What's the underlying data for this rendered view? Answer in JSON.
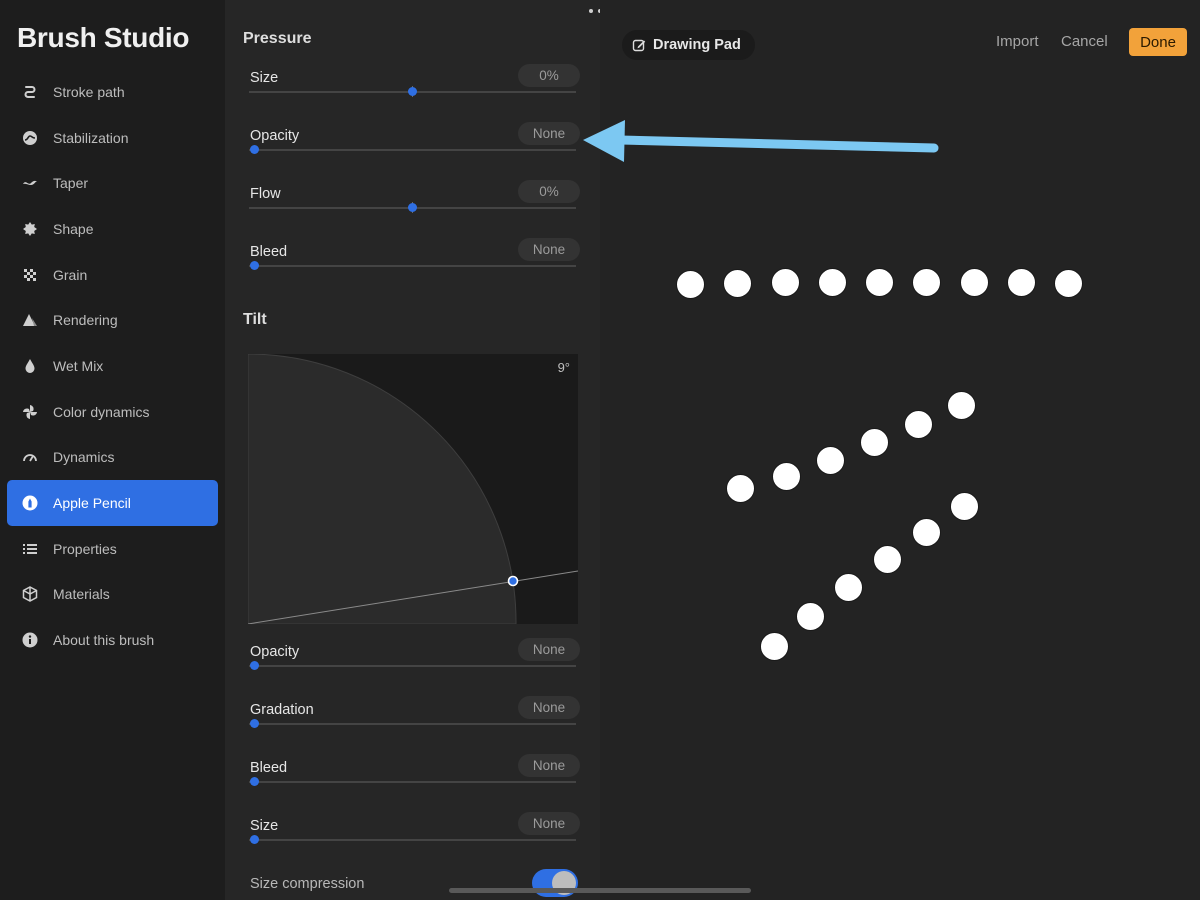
{
  "app_title": "Brush Studio",
  "sidebar": {
    "items": [
      {
        "label": "Stroke path",
        "icon": "stroke-path-icon"
      },
      {
        "label": "Stabilization",
        "icon": "stabilization-icon"
      },
      {
        "label": "Taper",
        "icon": "taper-icon"
      },
      {
        "label": "Shape",
        "icon": "shape-icon"
      },
      {
        "label": "Grain",
        "icon": "grain-icon"
      },
      {
        "label": "Rendering",
        "icon": "rendering-icon"
      },
      {
        "label": "Wet Mix",
        "icon": "wet-mix-icon"
      },
      {
        "label": "Color dynamics",
        "icon": "color-dynamics-icon"
      },
      {
        "label": "Dynamics",
        "icon": "dynamics-icon"
      },
      {
        "label": "Apple Pencil",
        "icon": "apple-pencil-icon",
        "active": true
      },
      {
        "label": "Properties",
        "icon": "properties-icon"
      },
      {
        "label": "Materials",
        "icon": "materials-icon"
      },
      {
        "label": "About this brush",
        "icon": "info-icon"
      }
    ]
  },
  "panel": {
    "pressure": {
      "title": "Pressure",
      "rows": [
        {
          "label": "Size",
          "value": "0%",
          "level": 0.5
        },
        {
          "label": "Opacity",
          "value": "None",
          "level": 0
        },
        {
          "label": "Flow",
          "value": "0%",
          "level": 0.5
        },
        {
          "label": "Bleed",
          "value": "None",
          "level": 0
        }
      ]
    },
    "tilt": {
      "title": "Tilt",
      "angle": "9°",
      "rows": [
        {
          "label": "Opacity",
          "value": "None",
          "level": 0
        },
        {
          "label": "Gradation",
          "value": "None",
          "level": 0
        },
        {
          "label": "Bleed",
          "value": "None",
          "level": 0
        },
        {
          "label": "Size",
          "value": "None",
          "level": 0
        }
      ]
    },
    "size_compression": {
      "label": "Size compression",
      "on": true
    }
  },
  "pad": {
    "title": "Drawing Pad",
    "import_label": "Import",
    "cancel_label": "Cancel",
    "done_label": "Done",
    "accent_color": "#2f6fe3",
    "done_color": "#f2a23a",
    "annotation_color": "#7cc8f2"
  }
}
